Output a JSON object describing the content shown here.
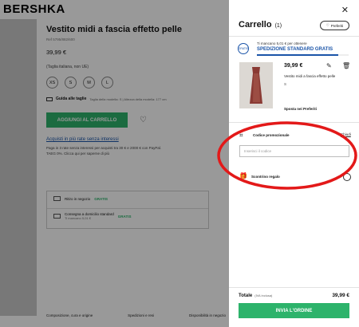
{
  "page": {
    "logo": "BERSHKA",
    "product": {
      "title": "Vestito midi a fascia effetto pelle",
      "ref": "Ref 5795/882/600",
      "price": "39,99 €",
      "size_note": "(Taglia italiana, non UE)",
      "sizes": [
        "XS",
        "S",
        "M",
        "L"
      ],
      "size_guide": {
        "label": "Guida alle taglie",
        "note": "Taglia della modella: S | Altezza della modella: 177 cm"
      },
      "add_to_cart": "AGGIUNGI AL CARRELLO",
      "installments_link": "Acquisti in più rate senza interessi",
      "installments_text": "Paga in 3 rate senza interessi per acquisti tra 30 € e 2000 € con PayPal. TAEG 0%. Clicca qui per saperne di più"
    },
    "delivery": [
      {
        "label": "Ritiro in negozio",
        "badge": "GRATIS",
        "sub": ""
      },
      {
        "label": "Consegna a domicilio standard",
        "badge": "GRATIS",
        "sub": "Ti mancano 5,01 €"
      }
    ],
    "footer_links": [
      "Composizione, cura e origine",
      "Spedizioni e resi",
      "Disponibilità in negozio"
    ]
  },
  "cart": {
    "title": "Carrello",
    "count": "(1)",
    "favorites_button": "Preferiti",
    "shipping": {
      "icon_text": "GRATIS",
      "remaining": "Ti mancano 5,01 € per ottenere",
      "offer": "SPEDIZIONE STANDARD GRATIS",
      "progress": 0.89
    },
    "item": {
      "price": "39,99 €",
      "name": "Vestito midi a fascia effetto pelle",
      "size": "S",
      "move_to_favorites": "Sposta nei Preferiti"
    },
    "promo": {
      "label": "Codice promozionale",
      "close": "Chiudi",
      "placeholder": "Inserisci il codice"
    },
    "gift": {
      "label": "Scontrino regalo"
    },
    "total": {
      "label": "Totale",
      "vat": "(IVA inclusa)",
      "value": "39,99 €"
    },
    "checkout": "INVIA L'ORDINE"
  },
  "colors": {
    "accent_green": "#2db36b",
    "link_blue": "#1a54a8",
    "annotation_red": "#e31919"
  },
  "icons": [
    "close-icon",
    "heart-icon",
    "edit-icon",
    "trash-icon",
    "promo-tag-icon",
    "gift-icon",
    "store-icon",
    "truck-icon",
    "ruler-icon"
  ]
}
